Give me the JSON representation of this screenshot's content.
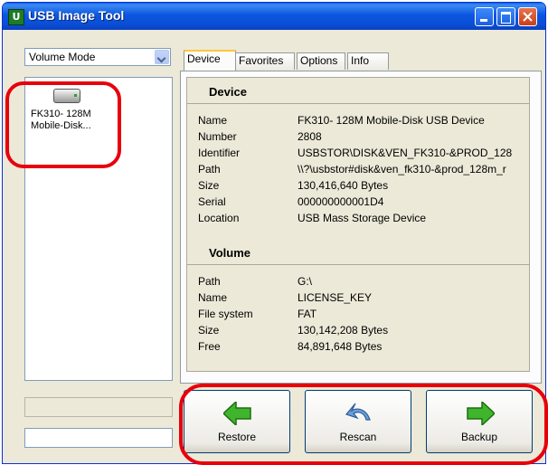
{
  "window": {
    "title": "USB Image Tool",
    "app_icon_letter": "U"
  },
  "mode_select": {
    "selected": "Volume Mode"
  },
  "device_list": [
    {
      "label_line1": "FK310- 128M",
      "label_line2": "Mobile-Disk..."
    }
  ],
  "tabs": [
    "Device",
    "Favorites",
    "Options",
    "Info"
  ],
  "device_section": {
    "heading": "Device",
    "rows": [
      {
        "name": "Name",
        "value": "FK310- 128M Mobile-Disk USB Device"
      },
      {
        "name": "Number",
        "value": "2808"
      },
      {
        "name": "Identifier",
        "value": "USBSTOR\\DISK&VEN_FK310-&PROD_128"
      },
      {
        "name": "Path",
        "value": "\\\\?\\usbstor#disk&ven_fk310-&prod_128m_r"
      },
      {
        "name": "Size",
        "value": "130,416,640 Bytes"
      },
      {
        "name": "Serial",
        "value": "000000000001D4"
      },
      {
        "name": "Location",
        "value": "USB Mass Storage Device"
      }
    ]
  },
  "volume_section": {
    "heading": "Volume",
    "rows": [
      {
        "name": "Path",
        "value": "G:\\"
      },
      {
        "name": "Name",
        "value": "LICENSE_KEY"
      },
      {
        "name": "File system",
        "value": "FAT"
      },
      {
        "name": "Size",
        "value": "130,142,208 Bytes"
      },
      {
        "name": "Free",
        "value": "84,891,648 Bytes"
      }
    ]
  },
  "buttons": {
    "restore": "Restore",
    "rescan": "Rescan",
    "backup": "Backup"
  },
  "colors": {
    "highlight": "#e8000b",
    "titlebar": "#0a5fe6"
  }
}
